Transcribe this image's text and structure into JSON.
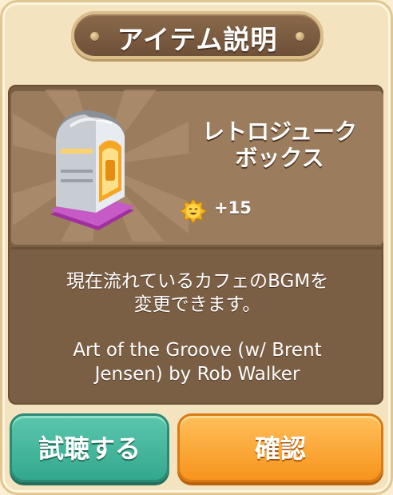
{
  "dialog": {
    "title": "アイテム説明"
  },
  "item": {
    "name_line1": "レトロジューク",
    "name_line2": "ボックス",
    "bonus_icon": "smiley-sun-icon",
    "bonus": "+15",
    "description_line1": "現在流れているカフェのBGMを",
    "description_line2": "変更できます。",
    "track_line1": "Art of the Groove (w/ Brent",
    "track_line2": "Jensen) by Rob Walker"
  },
  "buttons": {
    "listen_label": "試聴する",
    "confirm_label": "確認"
  },
  "colors": {
    "panel": "#7b5f45",
    "listen_button": "#33a88e",
    "confirm_button": "#f7941d"
  }
}
